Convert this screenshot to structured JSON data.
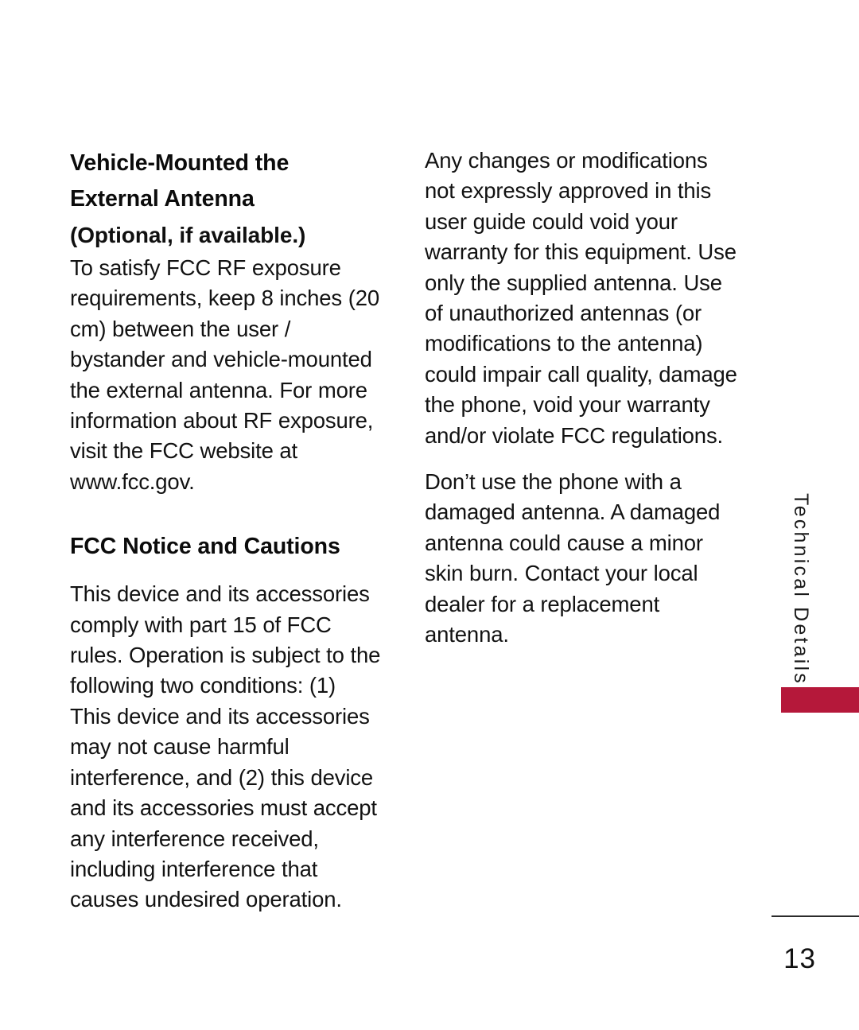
{
  "document": {
    "page_number": "13",
    "side_tab": {
      "label": "Technical Details",
      "accent_color": "#b5183a"
    }
  },
  "left_column": {
    "heading": "Vehicle-Mounted the External Antenna",
    "subheading": "(Optional, if available.)",
    "paragraph_1": "To satisfy FCC RF exposure requirements, keep 8 inches (20 cm) between the user / bystander and vehicle-mounted the external antenna. For more information about RF exposure, visit the FCC website at www.fcc.gov.",
    "heading_2": "FCC Notice and Cautions",
    "paragraph_2": "This device and its accessories comply with part 15 of FCC rules. Operation is subject to the following two conditions: (1) This device and its accessories may not cause harmful interference, and (2) this device and its accessories must accept any interference received, including interference that causes undesired operation."
  },
  "right_column": {
    "paragraph_1": "Any changes or modifications not expressly approved in this user guide could void your warranty for this equipment.  Use only the supplied antenna. Use of unauthorized antennas (or modifications to the antenna) could impair call quality, damage the phone, void your warranty and/or violate FCC regulations.",
    "paragraph_2": "Don’t use the phone with a damaged antenna. A damaged antenna could cause a minor skin burn. Contact your local dealer for a replacement antenna."
  }
}
